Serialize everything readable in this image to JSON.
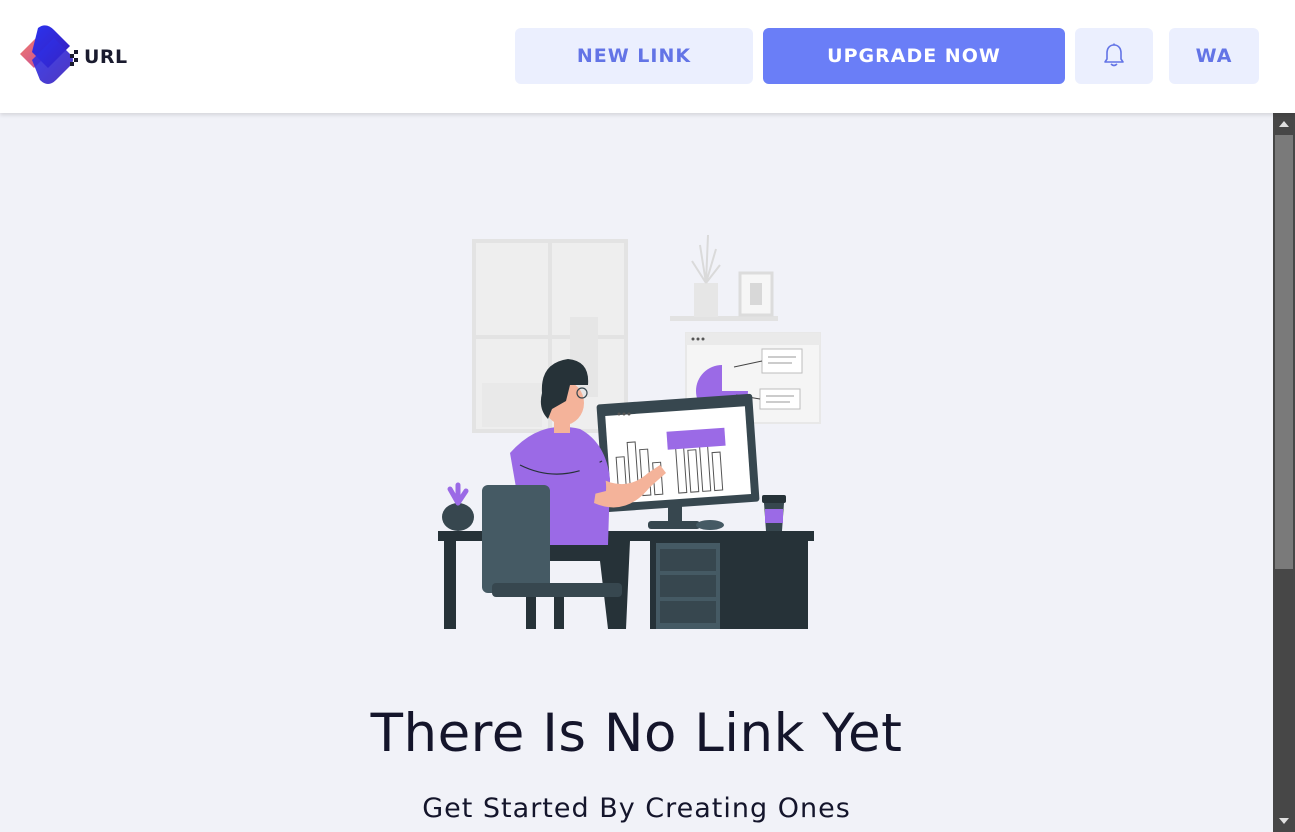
{
  "header": {
    "logo_text": "URL",
    "new_link_label": "NEW LINK",
    "upgrade_label": "UPGRADE NOW",
    "bell_icon": "bell-icon",
    "user_initials": "WA"
  },
  "empty_state": {
    "title": "There Is No Link Yet",
    "subtitle": "Get Started By Creating Ones"
  },
  "colors": {
    "accent": "#6a7ef7",
    "accent_light": "#ebeffe",
    "illustration_purple": "#9b6ae6",
    "background": "#f1f2f8"
  }
}
